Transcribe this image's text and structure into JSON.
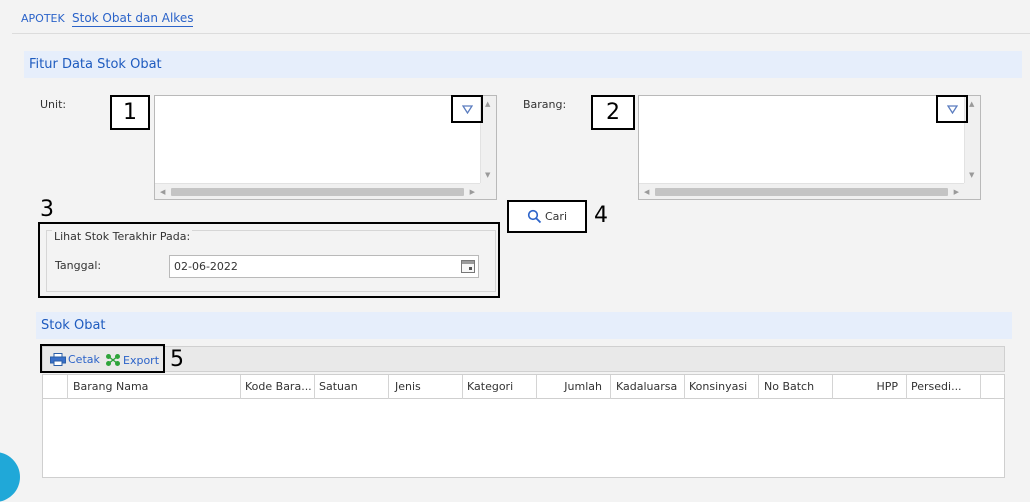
{
  "breadcrumb": {
    "root": "APOTEK",
    "current": "Stok Obat dan Alkes"
  },
  "filter_panel": {
    "title": "Fitur Data Stok Obat",
    "unit_label": "Unit:",
    "barang_label": "Barang:",
    "stock_group_legend": "Lihat Stok Terakhir Pada:",
    "tanggal_label": "Tanggal:",
    "tanggal_value": "02-06-2022",
    "search_button": "Cari"
  },
  "annotations": {
    "a1": "1",
    "a2": "2",
    "a3": "3",
    "a4": "4",
    "a5": "5"
  },
  "stock_section": {
    "title": "Stok Obat",
    "toolbar": {
      "print_label": "Cetak",
      "export_label": "Export"
    },
    "columns": [
      "Barang Nama",
      "Kode Bara...",
      "Satuan",
      "Jenis",
      "Kategori",
      "Jumlah",
      "Kadaluarsa",
      "Konsinyasi",
      "No Batch",
      "HPP",
      "Persedi..."
    ]
  },
  "colors": {
    "accent": "#1e5bbf",
    "link": "#2b63c9",
    "header_bg": "#e6eefb",
    "bubble": "#20a8d8"
  }
}
